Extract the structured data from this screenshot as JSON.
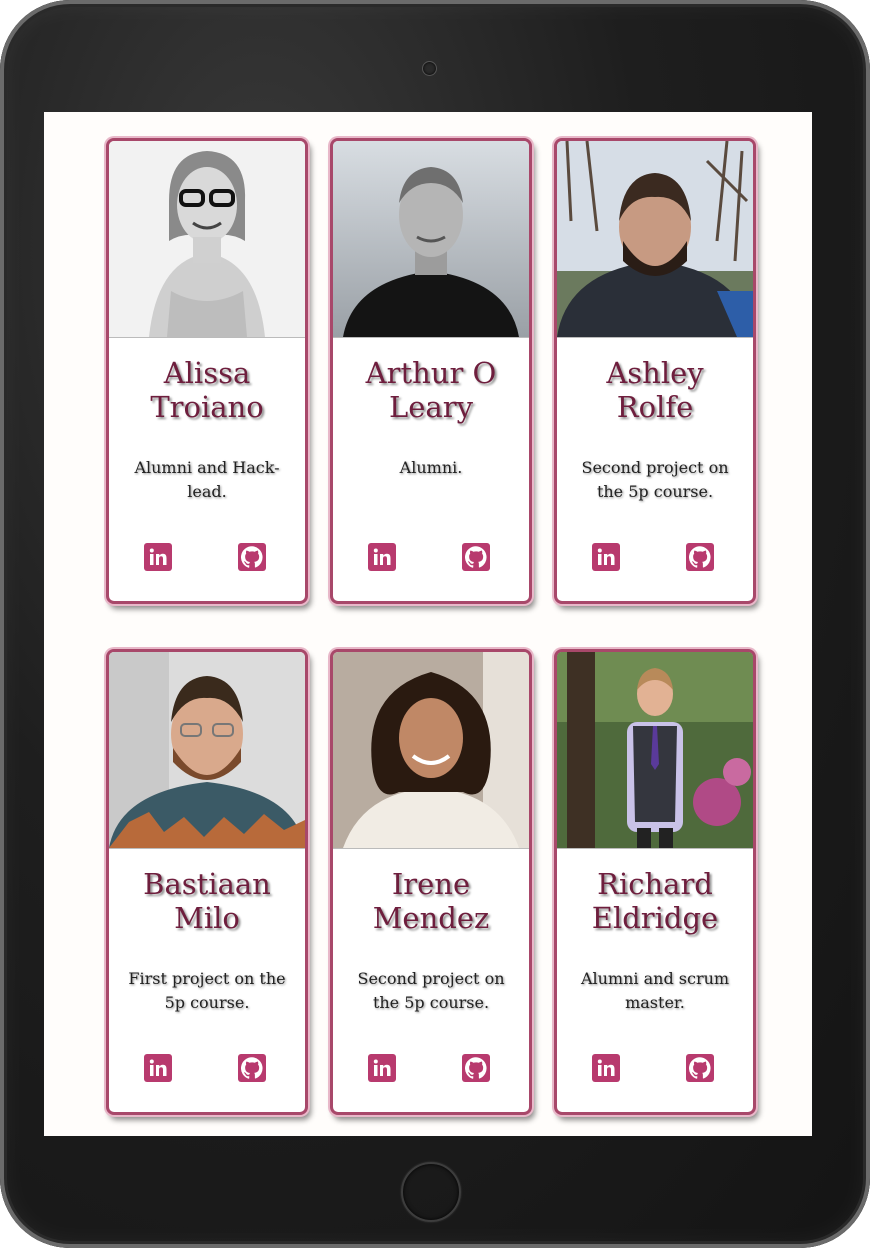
{
  "team": {
    "members": [
      {
        "name": "Alissa Troiano",
        "description": "Alumni and Hack-lead.",
        "photo_palette": "grayscale",
        "linkedin_icon": "linkedin-icon",
        "github_icon": "github-icon"
      },
      {
        "name": "Arthur O Leary",
        "description": "Alumni.",
        "photo_palette": "grayscale",
        "linkedin_icon": "linkedin-icon",
        "github_icon": "github-icon"
      },
      {
        "name": "Ashley Rolfe",
        "description": "Second project on the 5p course.",
        "photo_palette": "outdoor",
        "linkedin_icon": "linkedin-icon",
        "github_icon": "github-icon"
      },
      {
        "name": "Bastiaan Milo",
        "description": "First project on the 5p course.",
        "photo_palette": "indoor",
        "linkedin_icon": "linkedin-icon",
        "github_icon": "github-icon"
      },
      {
        "name": "Irene Mendez",
        "description": "Second project on the 5p course.",
        "photo_palette": "indoor",
        "linkedin_icon": "linkedin-icon",
        "github_icon": "github-icon"
      },
      {
        "name": "Richard Eldridge",
        "description": "Alumni and scrum master.",
        "photo_palette": "garden",
        "linkedin_icon": "linkedin-icon",
        "github_icon": "github-icon"
      }
    ]
  },
  "colors": {
    "accent": "#b83a6e",
    "border": "#a8486a",
    "name_text": "#6e1e3d",
    "device_frame": "#1e1e1e"
  }
}
